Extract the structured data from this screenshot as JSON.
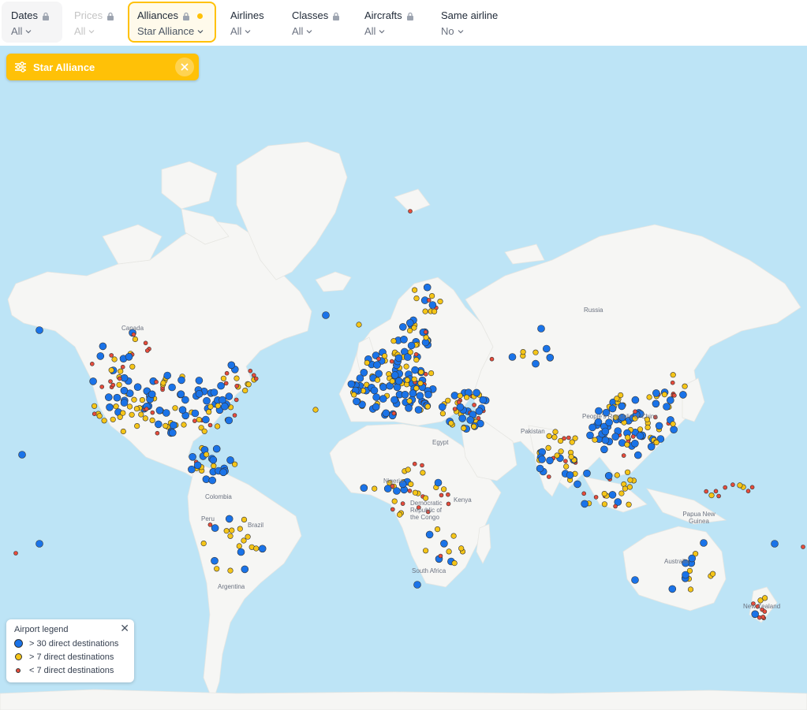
{
  "filters": [
    {
      "title": "Dates",
      "value": "All",
      "locked": true,
      "disabled": false,
      "active": false
    },
    {
      "title": "Prices",
      "value": "All",
      "locked": true,
      "disabled": true,
      "active": false
    },
    {
      "title": "Alliances",
      "value": "Star Alliance",
      "locked": true,
      "disabled": false,
      "active": true
    },
    {
      "title": "Airlines",
      "value": "All",
      "locked": false,
      "disabled": false,
      "active": false
    },
    {
      "title": "Classes",
      "value": "All",
      "locked": true,
      "disabled": false,
      "active": false
    },
    {
      "title": "Aircrafts",
      "value": "All",
      "locked": true,
      "disabled": false,
      "active": false
    },
    {
      "title": "Same airline",
      "value": "No",
      "locked": false,
      "disabled": false,
      "active": false
    }
  ],
  "chip": {
    "label": "Star Alliance"
  },
  "legend": {
    "title": "Airport legend",
    "items": [
      {
        "label": "> 30 direct destinations",
        "color": "#1a73e8"
      },
      {
        "label": "> 7 direct destinations",
        "color": "#f5c518"
      },
      {
        "label": "< 7 direct destinations",
        "color": "#e74c3c"
      }
    ]
  },
  "map_labels": {
    "canada": "Canada",
    "russia": "Russia",
    "brazil": "Brazil",
    "peru": "Peru",
    "colombia": "Colombia",
    "argentina": "Argentina",
    "nigeria": "Nigeria",
    "kenya": "Kenya",
    "drc": "Democratic Republic of the Congo",
    "south_africa": "South Africa",
    "australia": "Australia",
    "new_zealand": "New Zealand",
    "png": "Papua New Guinea",
    "egypt": "Egypt",
    "pakistan": "Pakistan",
    "china": "People's Republic of China"
  },
  "colors": {
    "ocean": "#bde4f6",
    "land": "#f6f6f4",
    "accent": "#ffc107",
    "hub": "#1a73e8",
    "mid": "#f5c518",
    "small": "#e74c3c"
  }
}
